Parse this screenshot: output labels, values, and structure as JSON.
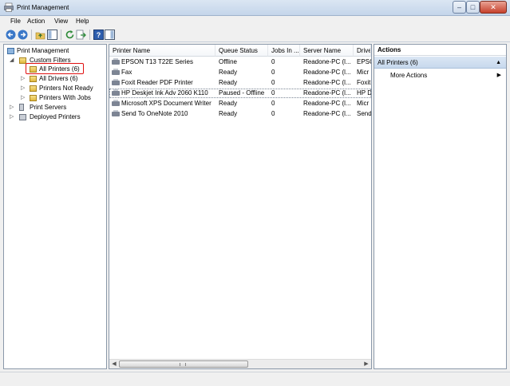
{
  "window": {
    "title": "Print Management"
  },
  "menu": {
    "file": "File",
    "action": "Action",
    "view": "View",
    "help": "Help"
  },
  "tree": {
    "root": "Print Management",
    "custom_filters": "Custom Filters",
    "all_printers": "All Printers (6)",
    "all_drivers": "All Drivers (6)",
    "printers_not_ready": "Printers Not Ready",
    "printers_with_jobs": "Printers With Jobs",
    "print_servers": "Print Servers",
    "deployed_printers": "Deployed Printers"
  },
  "list": {
    "columns": [
      "Printer Name",
      "Queue Status",
      "Jobs In ...",
      "Server Name",
      "Drive"
    ],
    "rows": [
      [
        "EPSON T13 T22E Series",
        "Offline",
        "0",
        "Readone-PC (l...",
        "EPSC"
      ],
      [
        "Fax",
        "Ready",
        "0",
        "Readone-PC (l...",
        "Micr"
      ],
      [
        "Foxit Reader PDF Printer",
        "Ready",
        "0",
        "Readone-PC (l...",
        "Foxit"
      ],
      [
        "HP Deskjet Ink Adv 2060 K110",
        "Paused - Offline",
        "0",
        "Readone-PC (l...",
        "HP D"
      ],
      [
        "Microsoft XPS Document Writer",
        "Ready",
        "0",
        "Readone-PC (l...",
        "Micr"
      ],
      [
        "Send To OneNote 2010",
        "Ready",
        "0",
        "Readone-PC (l...",
        "Send"
      ]
    ]
  },
  "actions": {
    "header": "Actions",
    "section": "All Printers (6)",
    "more_actions": "More Actions"
  }
}
